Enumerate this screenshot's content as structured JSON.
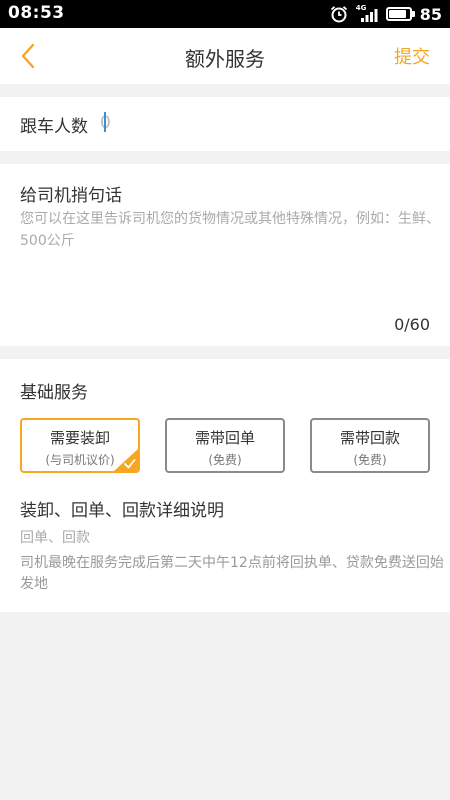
{
  "status_bar": {
    "time": "08:53",
    "signal_label": "4G",
    "battery_percent": "85",
    "battery_level": 0.85,
    "icons": [
      "alarm-icon",
      "signal-icon",
      "battery-icon"
    ]
  },
  "header": {
    "title": "额外服务",
    "submit_label": "提交",
    "back_icon": "chevron-left-icon",
    "accent_color": "#f5a623"
  },
  "riders": {
    "label": "跟车人数",
    "value": "",
    "placeholder": "0"
  },
  "message": {
    "label": "给司机捎句话",
    "value": "",
    "placeholder": "您可以在这里告诉司机您的货物情况或其他特殊情况，例如：生鲜、500公斤",
    "counter": "0/60"
  },
  "services": {
    "title": "基础服务",
    "options": [
      {
        "label": "需要装卸",
        "sub": "(与司机议价)",
        "selected": true
      },
      {
        "label": "需带回单",
        "sub": "(免费)",
        "selected": false
      },
      {
        "label": "需带回款",
        "sub": "(免费)",
        "selected": false
      }
    ],
    "detail_title": "装卸、回单、回款详细说明",
    "detail_sub": "回单、回款",
    "detail_desc": "司机最晚在服务完成后第二天中午12点前将回执单、贷款免费送回始发地"
  }
}
